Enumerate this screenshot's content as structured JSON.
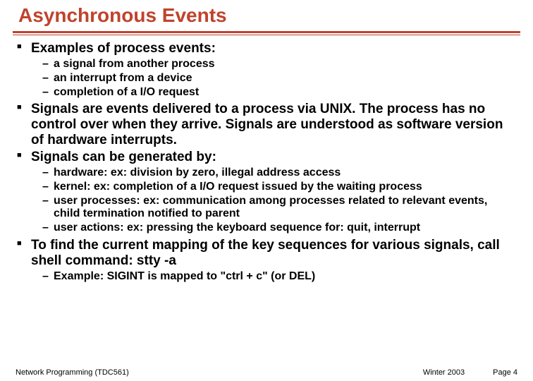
{
  "title": "Asynchronous Events",
  "bullets": {
    "b1": "Examples of process events:",
    "b1a": "a signal from another process",
    "b1b": "an interrupt from a device",
    "b1c": "completion of a I/O request",
    "b2": "Signals are events delivered to a process via UNIX. The process has no control over when they arrive. Signals are understood as software version of hardware interrupts.",
    "b3": "Signals can be generated by:",
    "b3a": "hardware: ex: division by zero, illegal address access",
    "b3b": "kernel: ex: completion of a I/O request issued by the waiting process",
    "b3c": "user processes: ex: communication among processes related to relevant events, child termination  notified to parent",
    "b3d": "user actions: ex: pressing the keyboard sequence for: quit, interrupt",
    "b4": "To find the current mapping of the key sequences for various signals, call shell command: stty -a",
    "b4a": "Example:  SIGINT is mapped to \"ctrl + c\" (or DEL)"
  },
  "footer": {
    "left": "Network Programming (TDC561)",
    "term": "Winter 2003",
    "page": "Page 4"
  }
}
